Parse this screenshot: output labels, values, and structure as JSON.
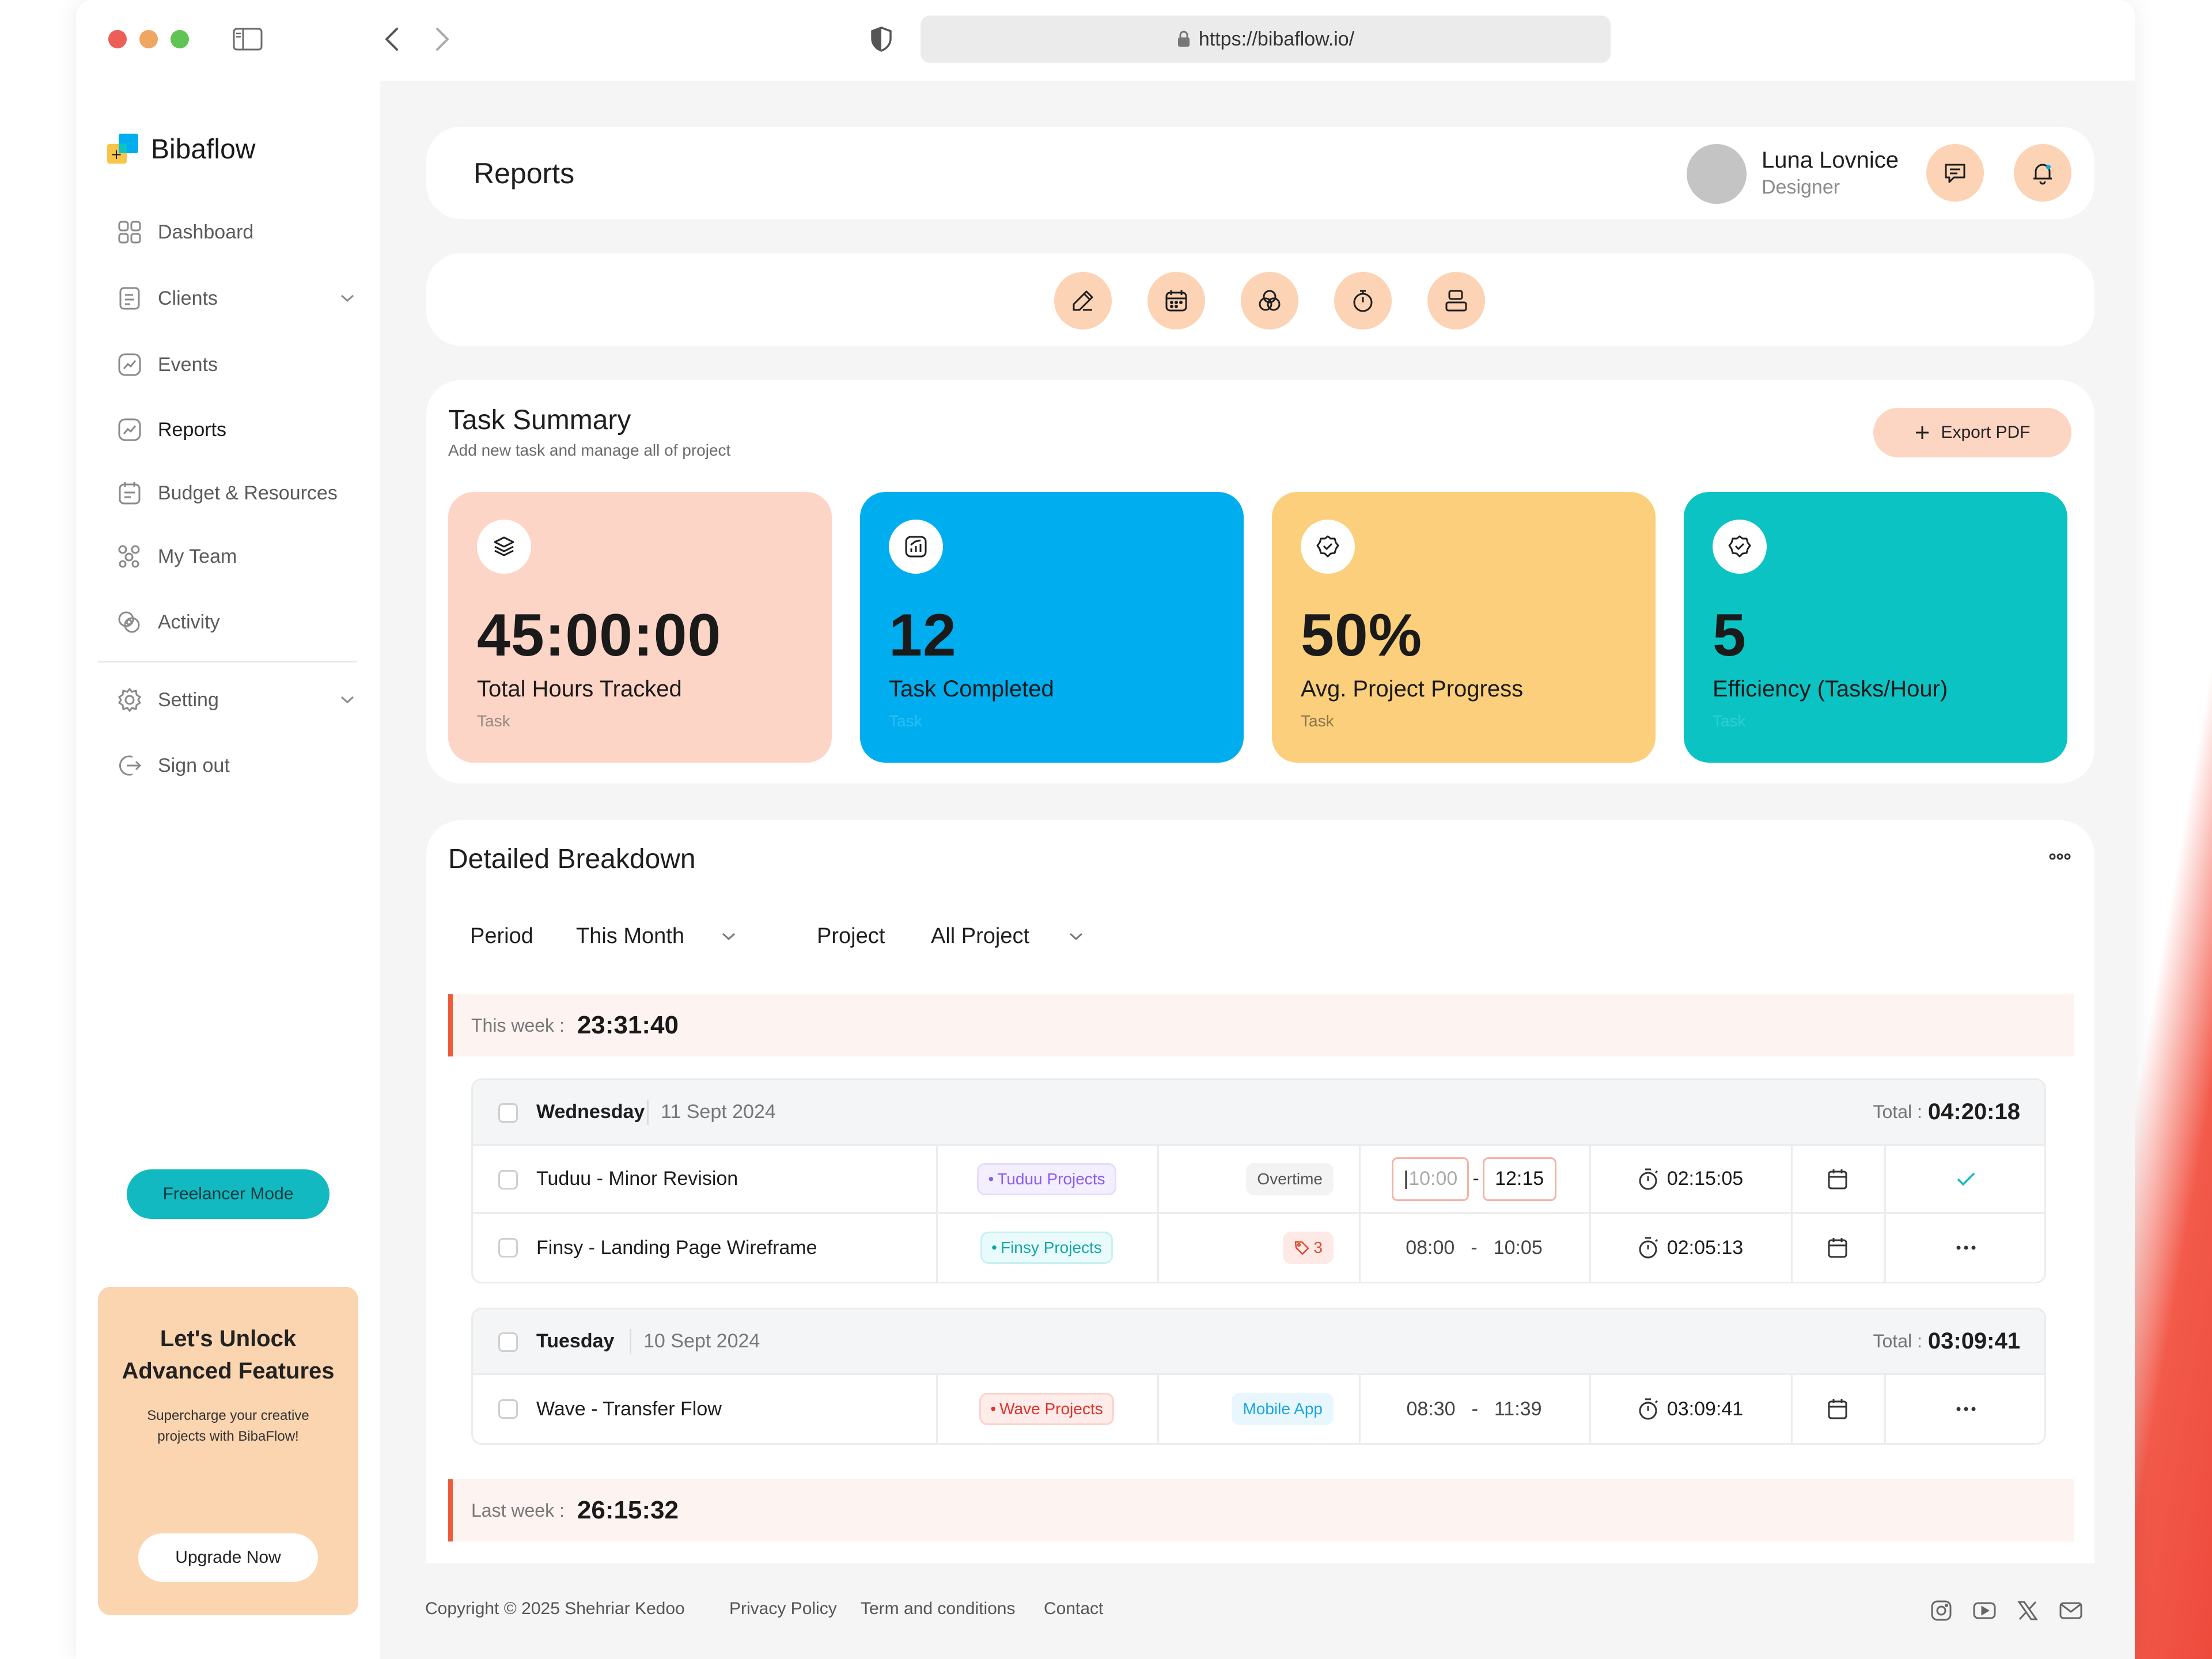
{
  "browser": {
    "url": "https://bibaflow.io/"
  },
  "app": {
    "name": "Bibaflow"
  },
  "sidebar": {
    "items": [
      {
        "label": "Dashboard",
        "icon": "grid-icon"
      },
      {
        "label": "Clients",
        "icon": "document-icon",
        "has_submenu": true
      },
      {
        "label": "Events",
        "icon": "chart-icon"
      },
      {
        "label": "Reports",
        "icon": "chart-icon",
        "active": true
      },
      {
        "label": "Budget & Resources",
        "icon": "calendar-icon"
      },
      {
        "label": "My Team",
        "icon": "team-icon"
      },
      {
        "label": "Activity",
        "icon": "activity-icon"
      }
    ],
    "secondary": [
      {
        "label": "Setting",
        "icon": "gear-icon",
        "has_submenu": true
      },
      {
        "label": "Sign out",
        "icon": "sign-out-icon"
      }
    ],
    "freelancer_mode": "Freelancer Mode",
    "promo": {
      "title_line1": "Let's Unlock",
      "title_line2": "Advanced Features",
      "text": "Supercharge your creative projects with BibaFlow!",
      "button": "Upgrade Now"
    }
  },
  "header": {
    "title": "Reports",
    "user": {
      "name": "Luna Lovnice",
      "role": "Designer"
    }
  },
  "toolbar": {
    "icons": [
      "edit-icon",
      "calendar-icon",
      "overlap-icon",
      "timer-icon",
      "layout-icon"
    ]
  },
  "task_summary": {
    "title": "Task Summary",
    "subtitle": "Add new task and manage all of project",
    "export_label": "Export PDF",
    "stats": [
      {
        "value": "45:00:00",
        "label": "Total Hours Tracked",
        "sub": "Task",
        "color": "#fdd5c6",
        "icon": "layers-icon"
      },
      {
        "value": "12",
        "label": "Task Completed",
        "sub": "Task",
        "color": "#00aeef",
        "icon": "chart-icon"
      },
      {
        "value": "50%",
        "label": "Avg. Project Progress",
        "sub": "Task",
        "color": "#fbcf7b",
        "icon": "badge-check-icon"
      },
      {
        "value": "5",
        "label": "Efficiency (Tasks/Hour)",
        "sub": "Task",
        "color": "#0cc3c4",
        "icon": "badge-check-icon"
      }
    ]
  },
  "breakdown": {
    "title": "Detailed Breakdown",
    "period_label": "Period",
    "period_value": "This Month",
    "project_label": "Project",
    "project_value": "All Project",
    "this_week_label": "This week :",
    "this_week_value": "23:31:40",
    "last_week_label": "Last week :",
    "last_week_value": "26:15:32",
    "total_label": "Total :",
    "groups": [
      {
        "day": "Wednesday",
        "date": "11 Sept 2024",
        "total": "04:20:18",
        "rows": [
          {
            "name": "Tuduu - Minor Revision",
            "project": "Tuduu Projects",
            "extra": "Overtime",
            "start": "10:00",
            "sep": "-",
            "end": "12:15",
            "duration": "02:15:05",
            "action": "check"
          },
          {
            "name": "Finsy - Landing Page Wireframe",
            "project": "Finsy Projects",
            "extra": "3",
            "start": "08:00",
            "sep": "-",
            "end": "10:05",
            "duration": "02:05:13",
            "action": "more"
          }
        ]
      },
      {
        "day": "Tuesday",
        "date": "10 Sept 2024",
        "total": "03:09:41",
        "rows": [
          {
            "name": "Wave - Transfer Flow",
            "project": "Wave Projects",
            "extra": "Mobile App",
            "start": "08:30",
            "sep": "-",
            "end": "11:39",
            "duration": "03:09:41",
            "action": "more"
          }
        ]
      }
    ]
  },
  "footer": {
    "copyright": "Copyright © 2025 Shehriar Kedoo",
    "links": [
      "Privacy Policy",
      "Term and conditions",
      "Contact"
    ],
    "social": [
      "instagram-icon",
      "youtube-icon",
      "x-icon",
      "mail-icon"
    ]
  }
}
